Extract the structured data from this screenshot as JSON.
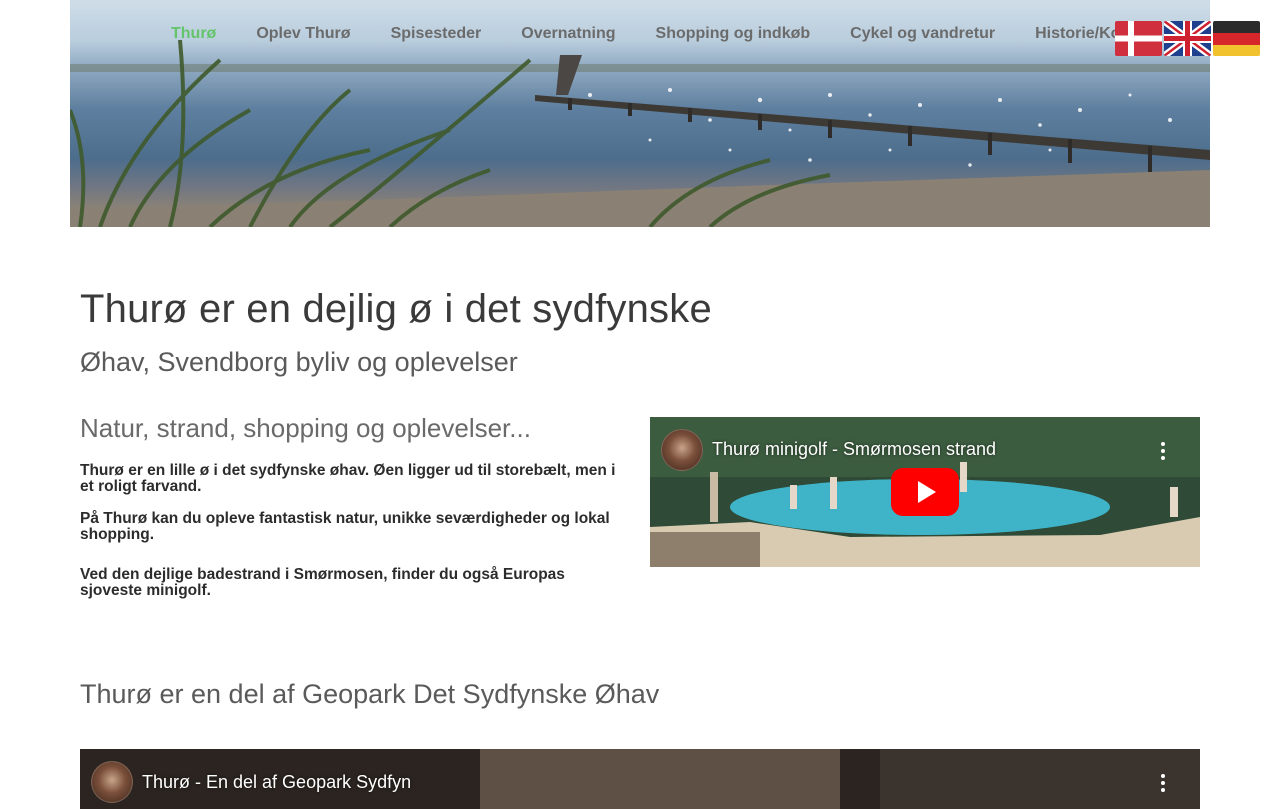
{
  "nav": {
    "items": [
      {
        "label": "Thurø",
        "active": true
      },
      {
        "label": "Oplev Thurø",
        "active": false
      },
      {
        "label": "Spisesteder",
        "active": false
      },
      {
        "label": "Overnatning",
        "active": false
      },
      {
        "label": "Shopping og indkøb",
        "active": false
      },
      {
        "label": "Cykel og vandretur",
        "active": false
      },
      {
        "label": "Historie/Kontakt",
        "active": false
      }
    ],
    "active_color": "#63c46b",
    "color": "#6b6b6b"
  },
  "languages": [
    {
      "name": "Danish",
      "icon": "danish-flag-icon"
    },
    {
      "name": "English",
      "icon": "uk-flag-icon"
    },
    {
      "name": "German",
      "icon": "german-flag-icon"
    }
  ],
  "hero": {
    "icon": "beach-pier-photo"
  },
  "headline": "Thurø er en dejlig ø i det sydfynske",
  "subheadline": "Øhav, Svendborg byliv og oplevelser",
  "section_title": "Natur, strand, shopping og oplevelser...",
  "paragraphs": [
    "Thurø er en lille ø i det sydfynske øhav. Øen ligger ud til storebælt, men i et roligt farvand.",
    "På Thurø kan du opleve fantastisk natur, unikke seværdigheder og lokal shopping.",
    "Ved den dejlige badestrand i Smørmosen, finder du også Europas sjoveste minigolf."
  ],
  "video1": {
    "title": "Thurø minigolf - Smørmosen strand"
  },
  "geopark_title": "Thurø er en del af Geopark Det Sydfynske Øhav",
  "video2": {
    "title": "Thurø - En del af Geopark Sydfyn"
  }
}
